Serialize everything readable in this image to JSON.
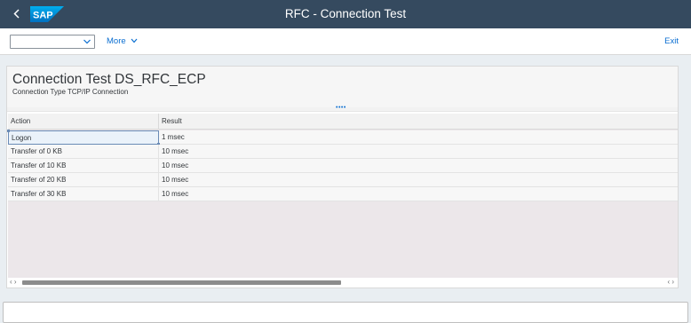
{
  "shell": {
    "title": "RFC - Connection Test",
    "logo_text": "SAP",
    "brand_color": "#0a6ed1",
    "shell_color": "#354a5f"
  },
  "toolbar": {
    "select_value": "",
    "more_label": "More",
    "exit_label": "Exit"
  },
  "header": {
    "title": "Connection Test DS_RFC_ECP",
    "subtitle": "Connection Type TCP/IP Connection"
  },
  "table": {
    "columns": [
      "Action",
      "Result"
    ],
    "rows": [
      {
        "action": "Logon",
        "result": "1 msec"
      },
      {
        "action": "Transfer of 0 KB",
        "result": "10 msec"
      },
      {
        "action": "Transfer of 10 KB",
        "result": "10 msec"
      },
      {
        "action": "Transfer of 20 KB",
        "result": "10 msec"
      },
      {
        "action": "Transfer of 30 KB",
        "result": "10 msec"
      }
    ]
  },
  "icons": {
    "back": "back-icon",
    "dropdown": "chevron-down-icon",
    "splitter": "splitter-dots-icon",
    "scroll_left": "scroll-left-icon",
    "scroll_right": "scroll-right-icon"
  }
}
